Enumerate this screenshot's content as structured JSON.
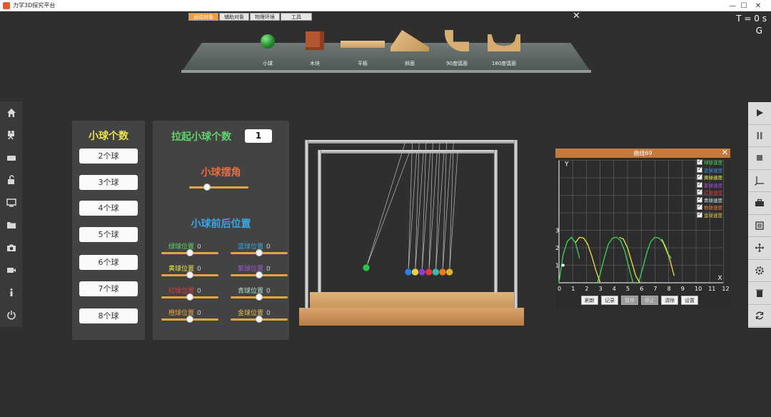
{
  "window": {
    "title": "力学3D探究平台",
    "min": "—",
    "max": "☐",
    "close": "✕"
  },
  "toolbox": {
    "tabs": [
      "运动对象",
      "辅助对象",
      "物理环境",
      "工具"
    ],
    "close": "✕",
    "items": [
      "小球",
      "木块",
      "平板",
      "斜面",
      "90度弧面",
      "180度弧面"
    ]
  },
  "status": {
    "time": "T = 0 s",
    "g": "G"
  },
  "left_toolbar": [
    "home-icon",
    "camera-rig-icon",
    "keyboard-icon",
    "unlock-icon",
    "monitor-icon",
    "folder-icon",
    "camera-icon",
    "video-icon",
    "info-icon",
    "power-icon"
  ],
  "right_toolbar": [
    "play-icon",
    "pause-icon",
    "stop-icon",
    "axes-icon",
    "toolbox-icon",
    "list-icon",
    "move-icon",
    "settings-icon",
    "trash-icon",
    "reset-icon"
  ],
  "ball_count": {
    "title": "小球个数",
    "options": [
      "2个球",
      "3个球",
      "4个球",
      "5个球",
      "6个球",
      "7个球",
      "8个球"
    ]
  },
  "settings": {
    "lift_label": "拉起小球个数",
    "lift_value": "1",
    "angle_label": "小球摆角",
    "angle_value": 0.3,
    "position_label": "小球前后位置",
    "positions": [
      {
        "label": "绿球位置",
        "value": "0",
        "color": "#5fd36b"
      },
      {
        "label": "蓝球位置",
        "value": "0",
        "color": "#3aa5e6"
      },
      {
        "label": "黄球位置",
        "value": "0",
        "color": "#e8e34a"
      },
      {
        "label": "紫球位置",
        "value": "0",
        "color": "#9b59d0"
      },
      {
        "label": "红球位置",
        "value": "0",
        "color": "#e23b3b"
      },
      {
        "label": "青球位置",
        "value": "0",
        "color": "#a8e3c8"
      },
      {
        "label": "橙球位置",
        "value": "0",
        "color": "#f0a040"
      },
      {
        "label": "金球位置",
        "value": "0",
        "color": "#e8c24a"
      }
    ]
  },
  "balls": {
    "colors": [
      "#2fbf4a",
      "#2f7fe0",
      "#e8d33a",
      "#8a3fd0",
      "#e03a3a",
      "#30c0b0",
      "#f07a20",
      "#e0b030"
    ]
  },
  "graph": {
    "title": "曲线69",
    "close": "✕",
    "legend": [
      {
        "label": "绿球速度",
        "color": "#3fd35a"
      },
      {
        "label": "蓝球速度",
        "color": "#3a8fe6"
      },
      {
        "label": "黄球速度",
        "color": "#e8e34a"
      },
      {
        "label": "紫球速度",
        "color": "#a050e0"
      },
      {
        "label": "红球速度",
        "color": "#e23b3b"
      },
      {
        "label": "青球速度",
        "color": "#cfe8e8"
      },
      {
        "label": "橙球速度",
        "color": "#f07a30"
      },
      {
        "label": "金球速度",
        "color": "#e8c24a"
      }
    ],
    "buttons": [
      "刷新",
      "记录",
      "暂停",
      "停止",
      "清除",
      "设置"
    ],
    "chart_data": {
      "type": "line",
      "xlabel": "X",
      "ylabel": "Y",
      "xlim": [
        0,
        12
      ],
      "ylim": [
        0,
        7
      ],
      "xticks": [
        "0",
        "1",
        "2",
        "3",
        "4",
        "5",
        "6",
        "7",
        "8",
        "9",
        "10",
        "11",
        "12"
      ],
      "yticks": [
        "1",
        "2",
        "3"
      ],
      "series": [
        {
          "name": "绿球速度",
          "x": [
            0,
            0.3,
            0.6,
            0.9,
            1.2,
            1.5
          ],
          "y": [
            0,
            1.6,
            2.35,
            2.6,
            2.3,
            1.4
          ]
        },
        {
          "name": "绿球速度",
          "x": [
            2.8,
            3.0,
            3.3,
            3.6,
            3.9,
            4.2,
            4.5,
            4.8,
            5.1,
            5.4
          ],
          "y": [
            0,
            0.5,
            1.4,
            2.2,
            2.55,
            2.6,
            2.4,
            1.8,
            0.9,
            0
          ]
        },
        {
          "name": "绿球速度",
          "x": [
            5.8,
            6.1,
            6.4,
            6.7,
            7.0,
            7.3,
            7.6,
            7.9,
            8.2
          ],
          "y": [
            0,
            0.8,
            1.7,
            2.35,
            2.6,
            2.55,
            2.3,
            1.7,
            1.4
          ]
        },
        {
          "name": "黄球速度",
          "x": [
            1.2,
            1.5,
            1.8,
            2.1,
            2.4,
            2.7,
            3.0
          ],
          "y": [
            2.3,
            2.6,
            2.55,
            2.2,
            1.5,
            0.7,
            0
          ]
        },
        {
          "name": "黄球速度",
          "x": [
            4.4,
            4.7,
            5.0,
            5.3,
            5.6,
            5.9
          ],
          "y": [
            2.6,
            2.5,
            2.0,
            1.2,
            0.4,
            0
          ]
        },
        {
          "name": "黄球速度",
          "x": [
            7.5,
            7.8,
            8.1,
            8.4
          ],
          "y": [
            2.5,
            2.0,
            1.3,
            0.4
          ]
        }
      ]
    }
  }
}
